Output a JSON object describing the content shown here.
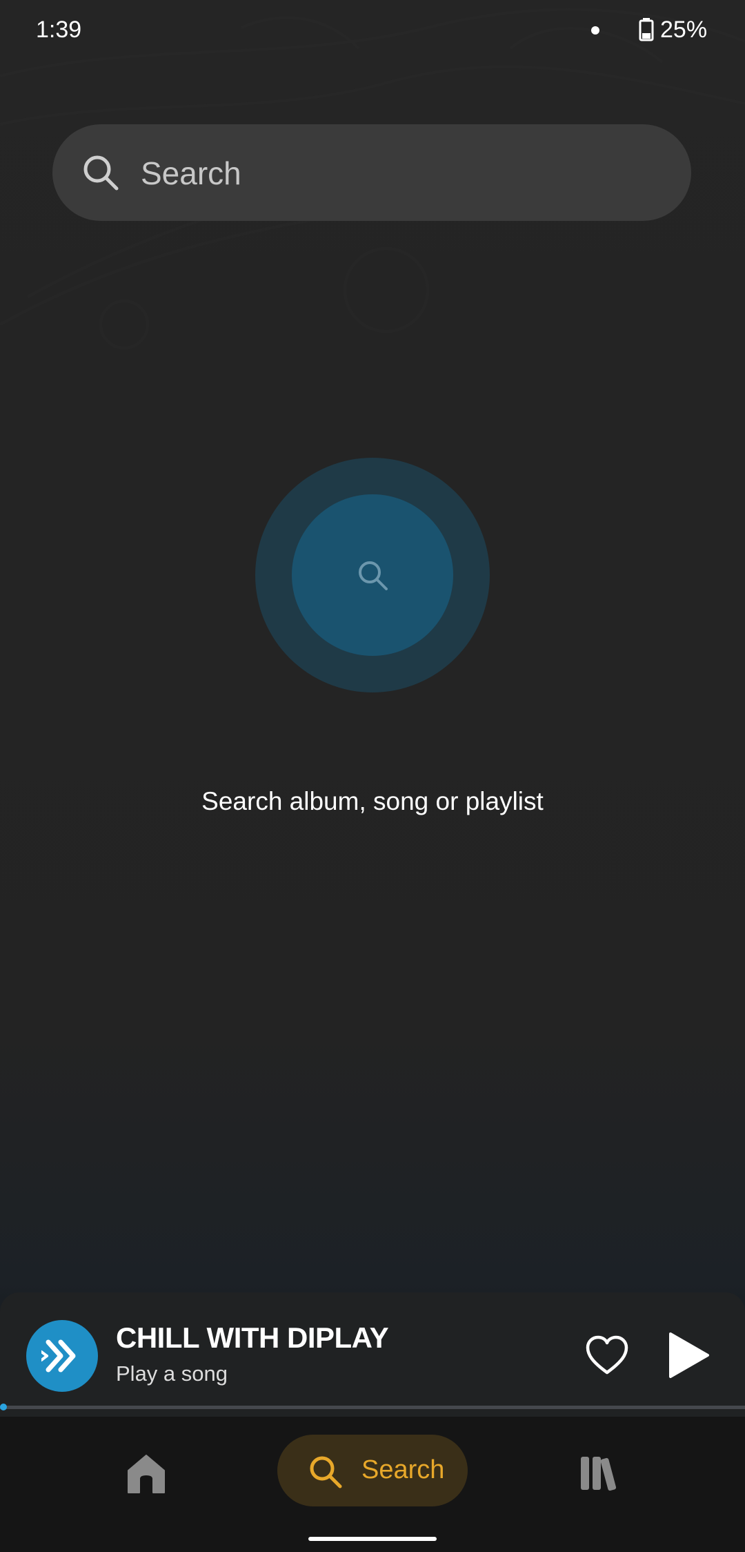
{
  "status_bar": {
    "time": "1:39",
    "battery": "25%"
  },
  "search": {
    "placeholder": "Search"
  },
  "empty_state": {
    "message": "Search album, song or playlist"
  },
  "mini_player": {
    "title": "CHILL WITH DIPLAY",
    "subtitle": "Play a song",
    "progress": 0
  },
  "bottom_nav": {
    "items": [
      {
        "icon": "home-icon",
        "label": ""
      },
      {
        "icon": "search-icon",
        "label": "Search",
        "active": true
      },
      {
        "icon": "library-icon",
        "label": ""
      }
    ]
  },
  "colors": {
    "background": "#232323",
    "search_bar": "#3b3b3b",
    "accent": "#e8a82a",
    "brand_blue": "#1f8fc6",
    "progress": "#2aa4e0"
  }
}
